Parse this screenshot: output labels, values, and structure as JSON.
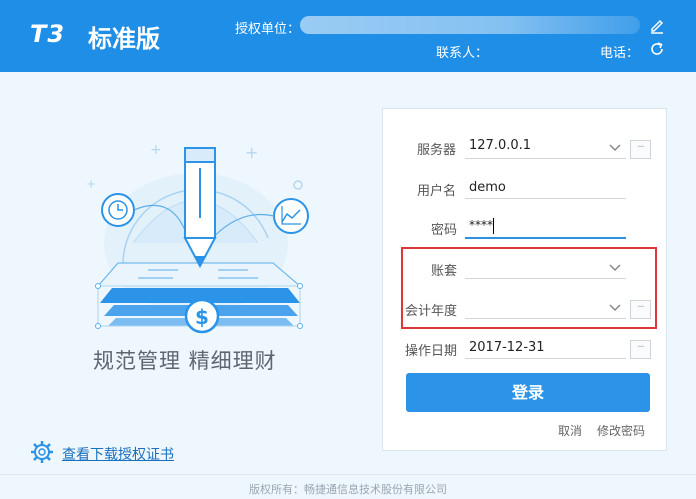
{
  "header": {
    "logo_mark": "T3",
    "product_name": "标准版",
    "licensee_label": "授权单位：",
    "contact_label": "联系人：",
    "phone_label": "电话："
  },
  "illustration": {
    "slogan": "规范管理  精细理财"
  },
  "license": {
    "link_text": "查看下载授权证书"
  },
  "login": {
    "server_label": "服务器",
    "server_value": "127.0.0.1",
    "server_more": "···",
    "user_label": "用户名",
    "user_value": "demo",
    "password_label": "密码",
    "password_value": "****",
    "account_set_label": "账套",
    "account_set_value": "",
    "fiscal_year_label": "会计年度",
    "fiscal_year_value": "",
    "fiscal_year_more": "···",
    "operate_date_label": "操作日期",
    "operate_date_value": "2017-12-31",
    "operate_date_more": "···",
    "login_button": "登录",
    "cancel_link": "取消",
    "change_password_link": "修改密码"
  },
  "footer": {
    "copyright": "版权所有：畅捷通信息技术股份有限公司"
  },
  "colors": {
    "header_bg": "#1f8ee6",
    "button_bg": "#2b93e8",
    "highlight_border": "#e0363a",
    "page_bg": "#eef7fd"
  }
}
